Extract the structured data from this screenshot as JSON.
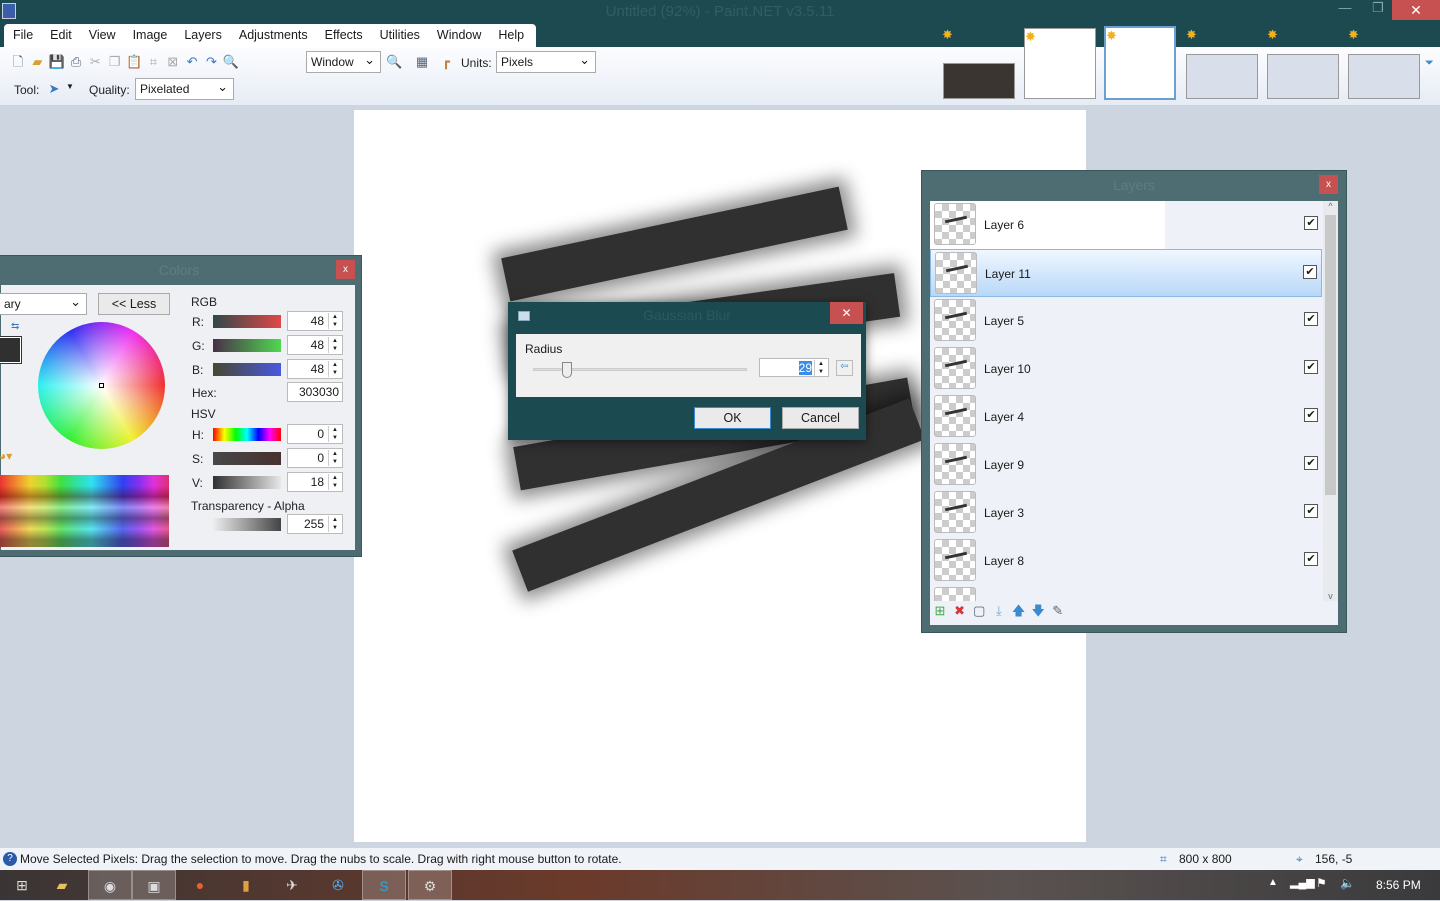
{
  "window": {
    "title": "Untitled (92%) - Paint.NET v3.5.11",
    "minimize": "—",
    "restore": "❐",
    "close": "✕"
  },
  "menu": [
    "File",
    "Edit",
    "View",
    "Image",
    "Layers",
    "Adjustments",
    "Effects",
    "Utilities",
    "Window",
    "Help"
  ],
  "toolbar": {
    "zoom_value": "Window",
    "units_label": "Units:",
    "units_value": "Pixels",
    "tool_label": "Tool:",
    "quality_label": "Quality:",
    "quality_value": "Pixelated"
  },
  "colors": {
    "title": "Colors",
    "close": "x",
    "mode_value": "ary",
    "less_button": "<< Less",
    "rgb_label": "RGB",
    "r_label": "R:",
    "g_label": "G:",
    "b_label": "B:",
    "r": "48",
    "g": "48",
    "b": "48",
    "hex_label": "Hex:",
    "hex": "303030",
    "hsv_label": "HSV",
    "h_label": "H:",
    "s_label": "S:",
    "v_label": "V:",
    "h": "0",
    "s": "0",
    "v": "18",
    "alpha_label": "Transparency - Alpha",
    "alpha": "255",
    "primary_color": "#303030"
  },
  "dialog": {
    "title": "Gaussian Blur",
    "close": "✕",
    "radius_label": "Radius",
    "radius": "29",
    "ok": "OK",
    "cancel": "Cancel"
  },
  "layers": {
    "title": "Layers",
    "close": "x",
    "items": [
      {
        "name": "Layer 6",
        "visible": true,
        "selected": false
      },
      {
        "name": "Layer 11",
        "visible": true,
        "selected": true
      },
      {
        "name": "Layer 5",
        "visible": true
      },
      {
        "name": "Layer 10",
        "visible": true
      },
      {
        "name": "Layer 4",
        "visible": true
      },
      {
        "name": "Layer 9",
        "visible": true
      },
      {
        "name": "Layer 3",
        "visible": true
      },
      {
        "name": "Layer 8",
        "visible": true
      }
    ]
  },
  "status": {
    "message": "Move Selected Pixels: Drag the selection to move. Drag the nubs to scale. Drag with right mouse button to rotate.",
    "image_size": "800 x 800",
    "cursor_pos": "156, -5"
  },
  "taskbar": {
    "time": "8:56 PM"
  }
}
